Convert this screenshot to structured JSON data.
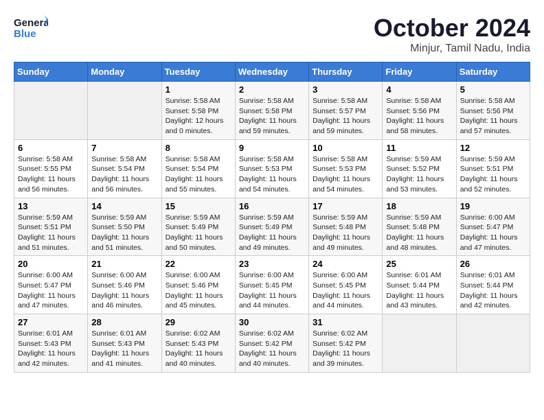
{
  "header": {
    "logo_general": "General",
    "logo_blue": "Blue",
    "month": "October 2024",
    "location": "Minjur, Tamil Nadu, India"
  },
  "weekdays": [
    "Sunday",
    "Monday",
    "Tuesday",
    "Wednesday",
    "Thursday",
    "Friday",
    "Saturday"
  ],
  "weeks": [
    [
      {
        "day": "",
        "empty": true
      },
      {
        "day": "",
        "empty": true
      },
      {
        "day": "1",
        "sunrise": "Sunrise: 5:58 AM",
        "sunset": "Sunset: 5:58 PM",
        "daylight": "Daylight: 12 hours and 0 minutes."
      },
      {
        "day": "2",
        "sunrise": "Sunrise: 5:58 AM",
        "sunset": "Sunset: 5:58 PM",
        "daylight": "Daylight: 11 hours and 59 minutes."
      },
      {
        "day": "3",
        "sunrise": "Sunrise: 5:58 AM",
        "sunset": "Sunset: 5:57 PM",
        "daylight": "Daylight: 11 hours and 59 minutes."
      },
      {
        "day": "4",
        "sunrise": "Sunrise: 5:58 AM",
        "sunset": "Sunset: 5:56 PM",
        "daylight": "Daylight: 11 hours and 58 minutes."
      },
      {
        "day": "5",
        "sunrise": "Sunrise: 5:58 AM",
        "sunset": "Sunset: 5:56 PM",
        "daylight": "Daylight: 11 hours and 57 minutes."
      }
    ],
    [
      {
        "day": "6",
        "sunrise": "Sunrise: 5:58 AM",
        "sunset": "Sunset: 5:55 PM",
        "daylight": "Daylight: 11 hours and 56 minutes."
      },
      {
        "day": "7",
        "sunrise": "Sunrise: 5:58 AM",
        "sunset": "Sunset: 5:54 PM",
        "daylight": "Daylight: 11 hours and 56 minutes."
      },
      {
        "day": "8",
        "sunrise": "Sunrise: 5:58 AM",
        "sunset": "Sunset: 5:54 PM",
        "daylight": "Daylight: 11 hours and 55 minutes."
      },
      {
        "day": "9",
        "sunrise": "Sunrise: 5:58 AM",
        "sunset": "Sunset: 5:53 PM",
        "daylight": "Daylight: 11 hours and 54 minutes."
      },
      {
        "day": "10",
        "sunrise": "Sunrise: 5:58 AM",
        "sunset": "Sunset: 5:53 PM",
        "daylight": "Daylight: 11 hours and 54 minutes."
      },
      {
        "day": "11",
        "sunrise": "Sunrise: 5:59 AM",
        "sunset": "Sunset: 5:52 PM",
        "daylight": "Daylight: 11 hours and 53 minutes."
      },
      {
        "day": "12",
        "sunrise": "Sunrise: 5:59 AM",
        "sunset": "Sunset: 5:51 PM",
        "daylight": "Daylight: 11 hours and 52 minutes."
      }
    ],
    [
      {
        "day": "13",
        "sunrise": "Sunrise: 5:59 AM",
        "sunset": "Sunset: 5:51 PM",
        "daylight": "Daylight: 11 hours and 51 minutes."
      },
      {
        "day": "14",
        "sunrise": "Sunrise: 5:59 AM",
        "sunset": "Sunset: 5:50 PM",
        "daylight": "Daylight: 11 hours and 51 minutes."
      },
      {
        "day": "15",
        "sunrise": "Sunrise: 5:59 AM",
        "sunset": "Sunset: 5:49 PM",
        "daylight": "Daylight: 11 hours and 50 minutes."
      },
      {
        "day": "16",
        "sunrise": "Sunrise: 5:59 AM",
        "sunset": "Sunset: 5:49 PM",
        "daylight": "Daylight: 11 hours and 49 minutes."
      },
      {
        "day": "17",
        "sunrise": "Sunrise: 5:59 AM",
        "sunset": "Sunset: 5:48 PM",
        "daylight": "Daylight: 11 hours and 49 minutes."
      },
      {
        "day": "18",
        "sunrise": "Sunrise: 5:59 AM",
        "sunset": "Sunset: 5:48 PM",
        "daylight": "Daylight: 11 hours and 48 minutes."
      },
      {
        "day": "19",
        "sunrise": "Sunrise: 6:00 AM",
        "sunset": "Sunset: 5:47 PM",
        "daylight": "Daylight: 11 hours and 47 minutes."
      }
    ],
    [
      {
        "day": "20",
        "sunrise": "Sunrise: 6:00 AM",
        "sunset": "Sunset: 5:47 PM",
        "daylight": "Daylight: 11 hours and 47 minutes."
      },
      {
        "day": "21",
        "sunrise": "Sunrise: 6:00 AM",
        "sunset": "Sunset: 5:46 PM",
        "daylight": "Daylight: 11 hours and 46 minutes."
      },
      {
        "day": "22",
        "sunrise": "Sunrise: 6:00 AM",
        "sunset": "Sunset: 5:46 PM",
        "daylight": "Daylight: 11 hours and 45 minutes."
      },
      {
        "day": "23",
        "sunrise": "Sunrise: 6:00 AM",
        "sunset": "Sunset: 5:45 PM",
        "daylight": "Daylight: 11 hours and 44 minutes."
      },
      {
        "day": "24",
        "sunrise": "Sunrise: 6:00 AM",
        "sunset": "Sunset: 5:45 PM",
        "daylight": "Daylight: 11 hours and 44 minutes."
      },
      {
        "day": "25",
        "sunrise": "Sunrise: 6:01 AM",
        "sunset": "Sunset: 5:44 PM",
        "daylight": "Daylight: 11 hours and 43 minutes."
      },
      {
        "day": "26",
        "sunrise": "Sunrise: 6:01 AM",
        "sunset": "Sunset: 5:44 PM",
        "daylight": "Daylight: 11 hours and 42 minutes."
      }
    ],
    [
      {
        "day": "27",
        "sunrise": "Sunrise: 6:01 AM",
        "sunset": "Sunset: 5:43 PM",
        "daylight": "Daylight: 11 hours and 42 minutes."
      },
      {
        "day": "28",
        "sunrise": "Sunrise: 6:01 AM",
        "sunset": "Sunset: 5:43 PM",
        "daylight": "Daylight: 11 hours and 41 minutes."
      },
      {
        "day": "29",
        "sunrise": "Sunrise: 6:02 AM",
        "sunset": "Sunset: 5:43 PM",
        "daylight": "Daylight: 11 hours and 40 minutes."
      },
      {
        "day": "30",
        "sunrise": "Sunrise: 6:02 AM",
        "sunset": "Sunset: 5:42 PM",
        "daylight": "Daylight: 11 hours and 40 minutes."
      },
      {
        "day": "31",
        "sunrise": "Sunrise: 6:02 AM",
        "sunset": "Sunset: 5:42 PM",
        "daylight": "Daylight: 11 hours and 39 minutes."
      },
      {
        "day": "",
        "empty": true
      },
      {
        "day": "",
        "empty": true
      }
    ]
  ]
}
